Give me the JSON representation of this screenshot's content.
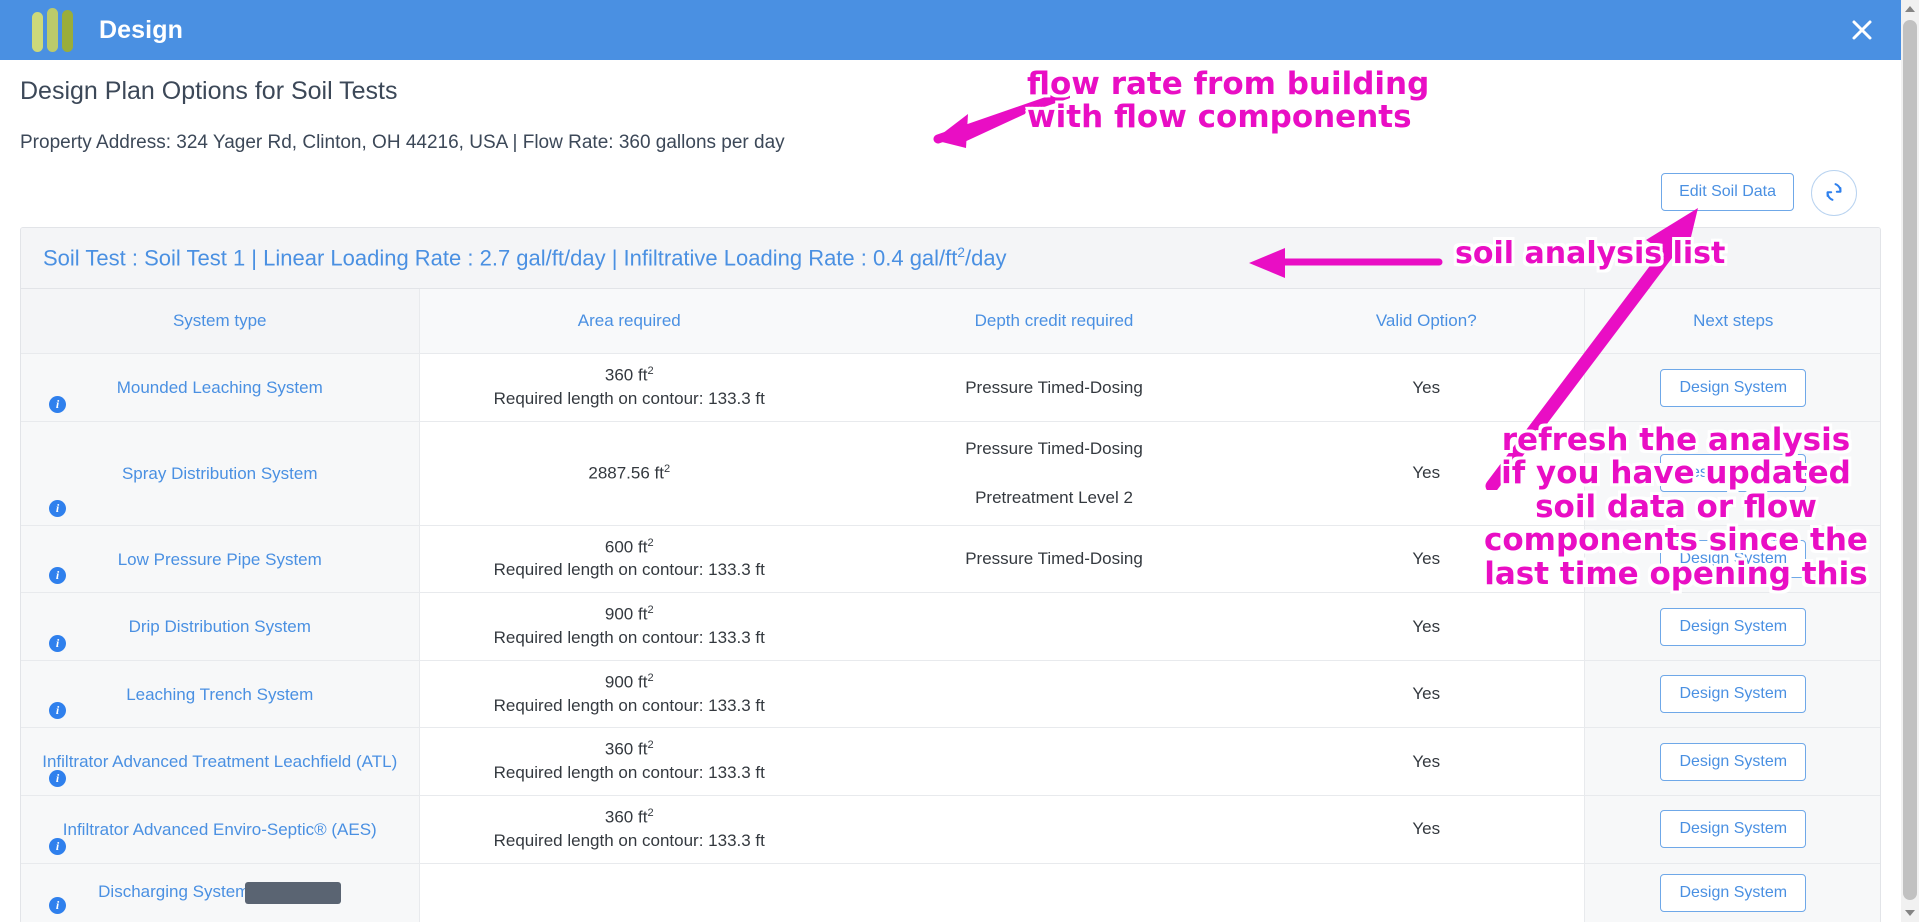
{
  "window": {
    "app_title": "Design",
    "logo_icon": "three-bars-logo",
    "close_icon": "close-icon"
  },
  "page": {
    "title": "Design Plan Options for Soil Tests",
    "property_line": "Property Address: 324 Yager Rd, Clinton, OH 44216, USA | Flow Rate: 360 gallons per day"
  },
  "toolbar": {
    "edit_soil_data_label": "Edit Soil Data",
    "refresh_icon": "refresh-icon"
  },
  "panel": {
    "header_prefix": "Soil Test : Soil Test 1 | Linear Loading Rate : 2.7  gal/ft/day | Infiltrative Loading Rate : 0.4  gal/ft",
    "header_sup": "2",
    "header_suffix": "/day"
  },
  "table": {
    "columns": [
      "System type",
      "Area required",
      "Depth credit required",
      "Valid Option?",
      "Next steps"
    ],
    "design_button_label": "Design System",
    "info_icon": "info-icon",
    "rows": [
      {
        "system": "Mounded Leaching System",
        "area_value": "360 ft",
        "area_sup": "2",
        "area_note": "Required length on contour: 133.3 ft",
        "depth": [
          "Pressure Timed-Dosing"
        ],
        "valid": "Yes",
        "action": "Design System"
      },
      {
        "system": "Spray Distribution System",
        "area_value": "2887.56 ft",
        "area_sup": "2",
        "area_note": "",
        "depth": [
          "Pressure Timed-Dosing",
          "Pretreatment Level 2"
        ],
        "valid": "Yes",
        "action": "Design System"
      },
      {
        "system": "Low Pressure Pipe System",
        "area_value": "600 ft",
        "area_sup": "2",
        "area_note": "Required length on contour: 133.3 ft",
        "depth": [
          "Pressure Timed-Dosing"
        ],
        "valid": "Yes",
        "action": "Design System"
      },
      {
        "system": "Drip Distribution System",
        "area_value": "900 ft",
        "area_sup": "2",
        "area_note": "Required length on contour: 133.3 ft",
        "depth": [],
        "valid": "Yes",
        "action": "Design System"
      },
      {
        "system": "Leaching Trench System",
        "area_value": "900 ft",
        "area_sup": "2",
        "area_note": "Required length on contour: 133.3 ft",
        "depth": [],
        "valid": "Yes",
        "action": "Design System"
      },
      {
        "system": "Infiltrator Advanced Treatment Leachfield (ATL)",
        "area_value": "360 ft",
        "area_sup": "2",
        "area_note": "Required length on contour: 133.3 ft",
        "depth": [],
        "valid": "Yes",
        "action": "Design System"
      },
      {
        "system": "Infiltrator Advanced Enviro-Septic® (AES)",
        "area_value": "360 ft",
        "area_sup": "2",
        "area_note": "Required length on contour: 133.3 ft",
        "depth": [],
        "valid": "Yes",
        "action": "Design System"
      },
      {
        "system": "Discharging System",
        "area_value": "",
        "area_sup": "",
        "area_note": "",
        "depth": [],
        "valid": "",
        "action": "Design System"
      }
    ]
  },
  "annotations": {
    "flow": "flow rate from building\nwith flow components",
    "soil_list": "soil analysis list",
    "refresh": "refresh the analysis\nif you have updated\nsoil data or flow\ncomponents since the\nlast time opening this",
    "color": "#e90ec4"
  },
  "colors": {
    "titlebar": "#4a90e2",
    "accent_blue": "#4a90e2",
    "annotation_magenta": "#e90ec4",
    "panel_header_bg": "#f4f5f7"
  }
}
